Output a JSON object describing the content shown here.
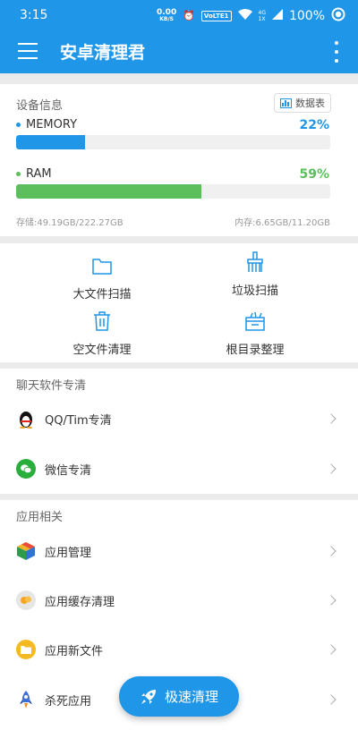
{
  "status": {
    "time": "3:15",
    "speed_value": "0.00",
    "speed_unit": "KB/S",
    "volte": "VoLTE1",
    "net_top": "4G",
    "net_bottom": "1X",
    "battery": "100%"
  },
  "appbar": {
    "title": "安卓清理君"
  },
  "device": {
    "label": "设备信息",
    "datatable_label": "数据表",
    "memory": {
      "label": "MEMORY",
      "percent_text": "22%",
      "percent": 22,
      "color": "#1f96e8"
    },
    "ram": {
      "label": "RAM",
      "percent_text": "59%",
      "percent": 59,
      "color": "#5cbf5c"
    },
    "storage": "存储:49.19GB/222.27GB",
    "memory_usage": "内存:6.65GB/11.20GB"
  },
  "tools": {
    "big_file_scan": "大文件扫描",
    "junk_scan": "垃圾扫描",
    "empty_file_clean": "空文件清理",
    "root_dir_tidy": "根目录整理"
  },
  "chat": {
    "title": "聊天软件专清",
    "items": [
      {
        "label": "QQ/Tim专清"
      },
      {
        "label": "微信专清"
      }
    ]
  },
  "apps": {
    "title": "应用相关",
    "items": [
      {
        "label": "应用管理"
      },
      {
        "label": "应用缓存清理"
      },
      {
        "label": "应用新文件"
      },
      {
        "label": "杀死应用"
      }
    ]
  },
  "fab": {
    "label": "极速清理"
  },
  "colors": {
    "primary": "#1f96e8",
    "green": "#5cbf5c"
  }
}
